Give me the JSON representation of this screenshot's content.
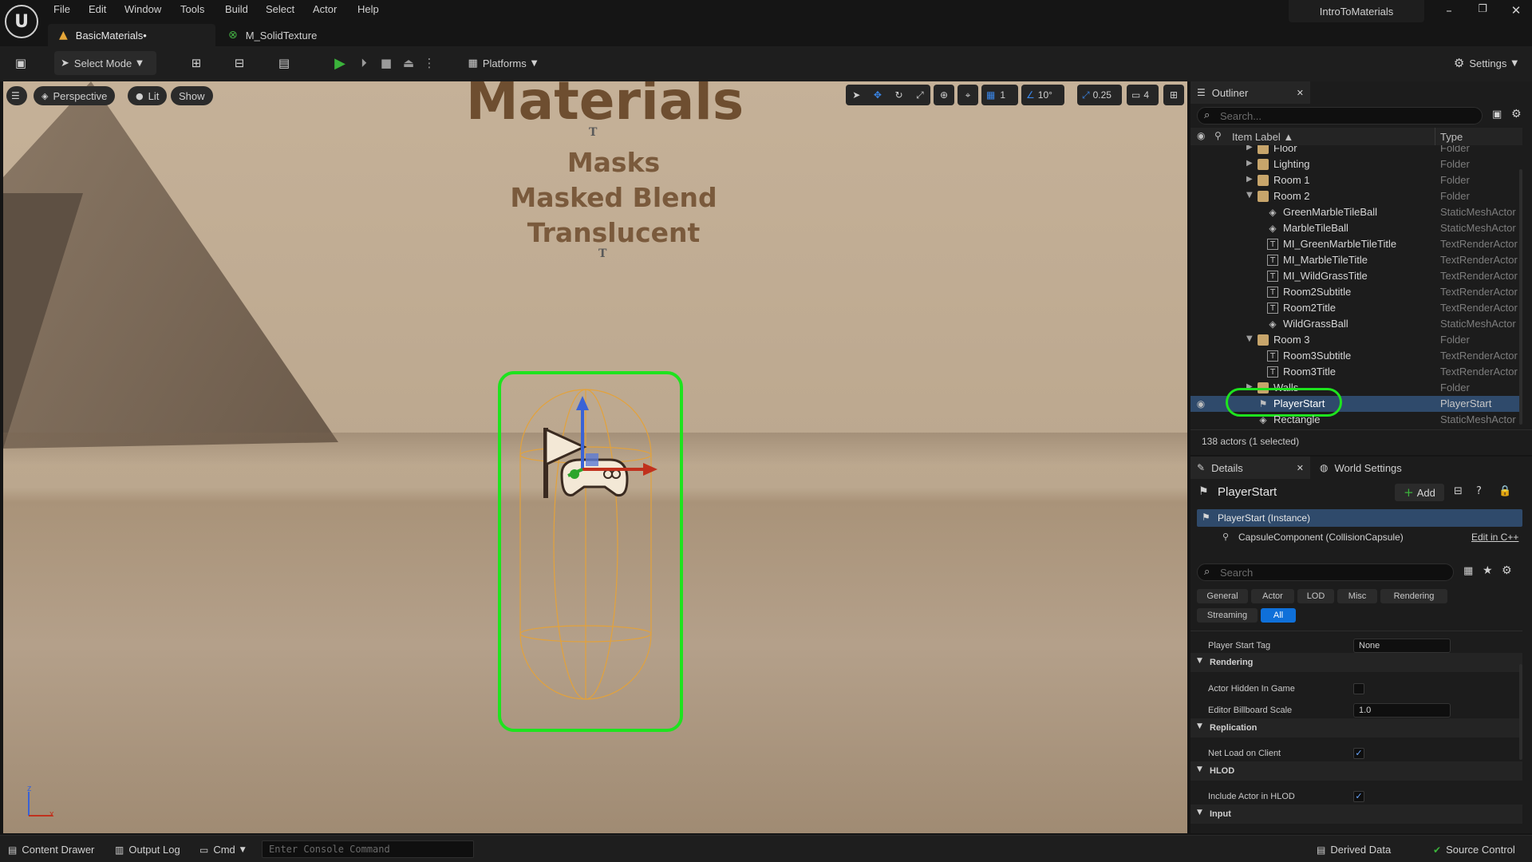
{
  "app": {
    "project_name": "IntroToMaterials",
    "logo_glyph": "U"
  },
  "menu": [
    "File",
    "Edit",
    "Window",
    "Tools",
    "Build",
    "Select",
    "Actor",
    "Help"
  ],
  "window_controls": [
    "–",
    "❐",
    "✕"
  ],
  "tabs": [
    {
      "label": "BasicMaterials•",
      "icon": "level-icon"
    },
    {
      "label": "M_SolidTexture",
      "icon": "material-icon"
    }
  ],
  "toolbar": {
    "select_mode": "Select Mode",
    "platforms": "Platforms",
    "settings": "Settings"
  },
  "viewport": {
    "perspective": "Perspective",
    "lit": "Lit",
    "show": "Show",
    "grid_snap": "1",
    "rotation_snap": "10°",
    "scale_snap": "0.25",
    "camera_speed": "4",
    "wall_title": "Materials",
    "wall_lines": [
      "Masks",
      "Masked Blend",
      "Translucent"
    ],
    "axis_z": "z",
    "axis_x": "x"
  },
  "outliner": {
    "tab_label": "Outliner",
    "search_placeholder": "Search...",
    "col_label": "Item Label ▲",
    "col_type": "Type",
    "rows": [
      {
        "label": "Floor",
        "type": "Folder"
      },
      {
        "label": "Lighting",
        "type": "Folder"
      },
      {
        "label": "Room 1",
        "type": "Folder"
      },
      {
        "label": "Room 2",
        "type": "Folder"
      },
      {
        "label": "GreenMarbleTileBall",
        "type": "StaticMeshActor"
      },
      {
        "label": "MarbleTileBall",
        "type": "StaticMeshActor"
      },
      {
        "label": "MI_GreenMarbleTileTitle",
        "type": "TextRenderActor"
      },
      {
        "label": "MI_MarbleTileTitle",
        "type": "TextRenderActor"
      },
      {
        "label": "MI_WildGrassTitle",
        "type": "TextRenderActor"
      },
      {
        "label": "Room2Subtitle",
        "type": "TextRenderActor"
      },
      {
        "label": "Room2Title",
        "type": "TextRenderActor"
      },
      {
        "label": "WildGrassBall",
        "type": "StaticMeshActor"
      },
      {
        "label": "Room 3",
        "type": "Folder"
      },
      {
        "label": "Room3Subtitle",
        "type": "TextRenderActor"
      },
      {
        "label": "Room3Title",
        "type": "TextRenderActor"
      },
      {
        "label": "Walls",
        "type": "Folder"
      },
      {
        "label": "PlayerStart",
        "type": "PlayerStart"
      },
      {
        "label": "Rectangle",
        "type": "StaticMeshActor"
      }
    ],
    "status": "138 actors (1 selected)"
  },
  "details": {
    "tab_label": "Details",
    "world_settings_label": "World Settings",
    "actor_name": "PlayerStart",
    "add_label": "Add",
    "instance_label": "PlayerStart (Instance)",
    "component_label": "CapsuleComponent (CollisionCapsule)",
    "edit_cpp": "Edit in C++",
    "search_placeholder": "Search",
    "filters": [
      "General",
      "Actor",
      "LOD",
      "Misc",
      "Rendering",
      "Streaming",
      "All"
    ],
    "player_start_tag_label": "Player Start Tag",
    "player_start_tag_value": "None",
    "sections": [
      "Rendering",
      "Replication",
      "HLOD",
      "Input"
    ],
    "actor_hidden_label": "Actor Hidden In Game",
    "billboard_scale_label": "Editor Billboard Scale",
    "billboard_scale_value": "1.0",
    "net_load_label": "Net Load on Client",
    "include_hlod_label": "Include Actor in HLOD"
  },
  "statusbar": {
    "content_drawer": "Content Drawer",
    "output_log": "Output Log",
    "cmd": "Cmd",
    "console_placeholder": "Enter Console Command",
    "derived_data": "Derived Data",
    "source_control": "Source Control"
  },
  "colors": {
    "selection_green": "#1ee31e",
    "accent_blue": "#0f70d9",
    "play_green": "#3bb33b"
  }
}
